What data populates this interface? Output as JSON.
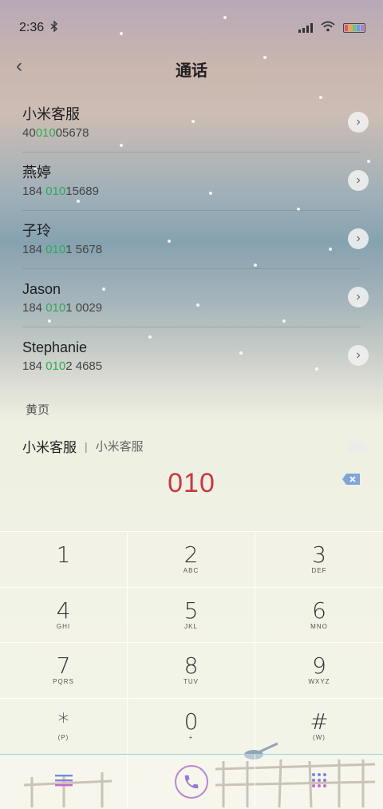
{
  "status_bar": {
    "time": "2:36",
    "bluetooth_icon": "bluetooth-icon",
    "signal_icon": "signal-icon",
    "wifi_icon": "wifi-icon",
    "battery_icon": "battery-icon"
  },
  "header": {
    "back_icon": "chevron-left-icon",
    "title": "通话"
  },
  "contacts": [
    {
      "name": "小米客服",
      "number_pre": "40",
      "number_hl": "010",
      "number_post": "05678"
    },
    {
      "name": "燕婷",
      "number_pre": "184 ",
      "number_hl": "010",
      "number_post": "15689"
    },
    {
      "name": "子玲",
      "number_pre": "184 ",
      "number_hl": "010",
      "number_post": "1 5678"
    },
    {
      "name": "Jason",
      "number_pre": "184 ",
      "number_hl": "010",
      "number_post": "1 0029"
    },
    {
      "name": "Stephanie",
      "number_pre": "184 ",
      "number_hl": "010",
      "number_post": "2 4685"
    }
  ],
  "yellow_pages": {
    "label": "黄页",
    "entry_name": "小米客服",
    "separator": "|",
    "entry_sub": "小米客服"
  },
  "dialer": {
    "input": "010"
  },
  "keypad": [
    {
      "digit": "1",
      "letters": ""
    },
    {
      "digit": "2",
      "letters": "ABC"
    },
    {
      "digit": "3",
      "letters": "DEF"
    },
    {
      "digit": "4",
      "letters": "GHI"
    },
    {
      "digit": "5",
      "letters": "JKL"
    },
    {
      "digit": "6",
      "letters": "MNO"
    },
    {
      "digit": "7",
      "letters": "PQRS"
    },
    {
      "digit": "8",
      "letters": "TUV"
    },
    {
      "digit": "9",
      "letters": "WXYZ"
    },
    {
      "digit": "*",
      "letters": "(P)"
    },
    {
      "digit": "0",
      "letters": "+"
    },
    {
      "digit": "#",
      "letters": "(W)"
    }
  ],
  "bottom_bar": {
    "menu_icon": "menu-icon",
    "call_icon": "phone-icon",
    "keypad_icon": "dialpad-icon"
  },
  "colors": {
    "highlight": "#2eaa55",
    "dial_text": "#c8393e",
    "call_ring": "#b887d2"
  }
}
